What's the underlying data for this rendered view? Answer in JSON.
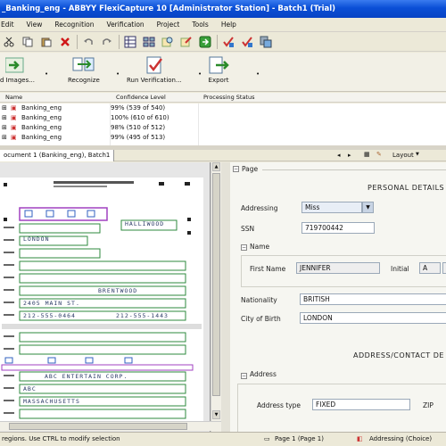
{
  "window": {
    "title": "_Banking_eng - ABBYY FlexiCapture 10 [Administrator Station] - Batch1 (Trial)"
  },
  "menu": [
    "Edit",
    "View",
    "Recognition",
    "Verification",
    "Project",
    "Tools",
    "Help"
  ],
  "toolbar_icons": [
    "cut-icon",
    "copy-icon",
    "paste-icon",
    "delete-icon",
    "undo-icon",
    "redo-icon",
    "grid-view-icon",
    "thumbnail-view-icon",
    "zoom-icon",
    "search-icon",
    "export-icon",
    "recognize-icon",
    "verify-icon",
    "settings-icon"
  ],
  "big_buttons": {
    "add_images": "d Images...",
    "recognize": "Recognize",
    "run_verification": "Run Verification...",
    "export": "Export"
  },
  "batch_columns": {
    "name": "Name",
    "confidence": "Confidence Level",
    "processing": "Processing Status"
  },
  "batch_rows": [
    {
      "name": "Banking_eng",
      "confidence": "99% (539 of 540)"
    },
    {
      "name": "Banking_eng",
      "confidence": "100% (610 of 610)"
    },
    {
      "name": "Banking_eng",
      "confidence": "98% (510 of 512)"
    },
    {
      "name": "Banking_eng",
      "confidence": "99% (495 of 513)"
    }
  ],
  "doc_tab": "ocument 1 (Banking_eng), Batch1",
  "layout_label": "Layout",
  "form": {
    "page_label": "Page",
    "section_personal": "PERSONAL DETAILS",
    "addressing_label": "Addressing",
    "addressing_value": "Miss",
    "ssn_label": "SSN",
    "ssn_value": "719700442",
    "name_group": "Name",
    "first_name_label": "First Name",
    "first_name_value": "JENNIFER",
    "initial_label": "Initial",
    "initial_value": "A",
    "nationality_label": "Nationality",
    "nationality_value": "BRITISH",
    "city_label": "City of Birth",
    "city_value": "LONDON",
    "section_address": "ADDRESS/CONTACT DE",
    "address_group": "Address",
    "address_type_label": "Address type",
    "address_type_value": "FIXED",
    "zip_label": "ZIP"
  },
  "status": {
    "left": "regions. Use CTRL to modify selection",
    "page": "Page 1 (Page 1)",
    "mode": "Addressing (Choice)"
  },
  "scan": {
    "lines": [
      "LONDON",
      "HALLIWOOD",
      "BRENTWOOD",
      "2405 MAIN ST.",
      "212-555-0464",
      "212-555-1443",
      "ABC ENTERTAIN CORP.",
      "MASSACHUSETTS",
      "ABC"
    ]
  }
}
